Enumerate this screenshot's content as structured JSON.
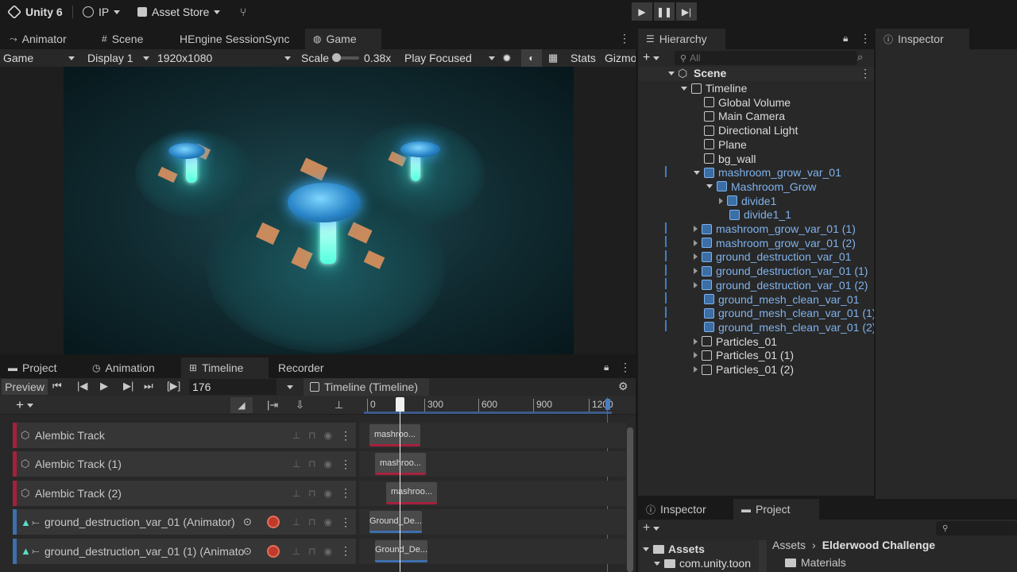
{
  "toolbar": {
    "app_title": "Unity 6",
    "account": "IP",
    "asset_store": "Asset Store"
  },
  "scene_tabs": [
    "Animator",
    "Scene",
    "HEngine SessionSync",
    "Game"
  ],
  "game_bar": {
    "view": "Game",
    "display": "Display 1",
    "resolution": "1920x1080",
    "scale_label": "Scale",
    "scale_value": "0.38x",
    "play_mode": "Play Focused",
    "stats": "Stats",
    "gizmos": "Gizmo"
  },
  "hierarchy": {
    "tab": "Hierarchy",
    "search_placeholder": "All",
    "scene": "Scene",
    "items": [
      {
        "label": "Timeline",
        "indent": 1,
        "arrow": "down",
        "prefab": false
      },
      {
        "label": "Global Volume",
        "indent": 2,
        "arrow": "",
        "prefab": false
      },
      {
        "label": "Main Camera",
        "indent": 2,
        "arrow": "",
        "prefab": false
      },
      {
        "label": "Directional Light",
        "indent": 2,
        "arrow": "",
        "prefab": false
      },
      {
        "label": "Plane",
        "indent": 2,
        "arrow": "",
        "prefab": false
      },
      {
        "label": "bg_wall",
        "indent": 2,
        "arrow": "",
        "prefab": false
      },
      {
        "label": "mashroom_grow_var_01",
        "indent": 2,
        "arrow": "down",
        "prefab": true
      },
      {
        "label": "Mashroom_Grow",
        "indent": 3,
        "arrow": "down",
        "prefab": true
      },
      {
        "label": "divide1",
        "indent": 4,
        "arrow": "right",
        "prefab": true
      },
      {
        "label": "divide1_1",
        "indent": 4,
        "arrow": "",
        "prefab": true
      },
      {
        "label": "mashroom_grow_var_01 (1)",
        "indent": 2,
        "arrow": "right",
        "prefab": true
      },
      {
        "label": "mashroom_grow_var_01 (2)",
        "indent": 2,
        "arrow": "right",
        "prefab": true
      },
      {
        "label": "ground_destruction_var_01",
        "indent": 2,
        "arrow": "right",
        "prefab": true
      },
      {
        "label": "ground_destruction_var_01 (1)",
        "indent": 2,
        "arrow": "right",
        "prefab": true
      },
      {
        "label": "ground_destruction_var_01 (2)",
        "indent": 2,
        "arrow": "right",
        "prefab": true
      },
      {
        "label": "ground_mesh_clean_var_01",
        "indent": 2,
        "arrow": "",
        "prefab": true
      },
      {
        "label": "ground_mesh_clean_var_01 (1)",
        "indent": 2,
        "arrow": "",
        "prefab": true
      },
      {
        "label": "ground_mesh_clean_var_01 (2)",
        "indent": 2,
        "arrow": "",
        "prefab": true
      },
      {
        "label": "Particles_01",
        "indent": 2,
        "arrow": "right",
        "prefab": false
      },
      {
        "label": "Particles_01 (1)",
        "indent": 2,
        "arrow": "right",
        "prefab": false
      },
      {
        "label": "Particles_01 (2)",
        "indent": 2,
        "arrow": "right",
        "prefab": false
      }
    ]
  },
  "inspector_tab": "Inspector",
  "bottom_tabs": [
    "Project",
    "Animation",
    "Timeline",
    "Recorder"
  ],
  "timeline": {
    "preview": "Preview",
    "frame": "176",
    "asset": "Timeline (Timeline)",
    "ruler": [
      "0",
      "300",
      "600",
      "900",
      "1200"
    ],
    "tracks": [
      {
        "label": "Alembic Track",
        "kind": "alembic",
        "clip": "mashroo..."
      },
      {
        "label": "Alembic Track (1)",
        "kind": "alembic",
        "clip": "mashroo..."
      },
      {
        "label": "Alembic Track (2)",
        "kind": "alembic",
        "clip": "mashroo..."
      },
      {
        "label": "ground_destruction_var_01 (Animator)",
        "kind": "animator",
        "clip": "Ground_De..."
      },
      {
        "label": "ground_destruction_var_01 (1) (Animato",
        "kind": "animator",
        "clip": "Ground_De..."
      }
    ]
  },
  "project_panel": {
    "tabs": [
      "Inspector",
      "Project"
    ],
    "tree_root": "Assets",
    "tree_child": "com.unity.toon",
    "breadcrumb_root": "Assets",
    "breadcrumb_current": "Elderwood Challenge",
    "folder": "Materials"
  }
}
